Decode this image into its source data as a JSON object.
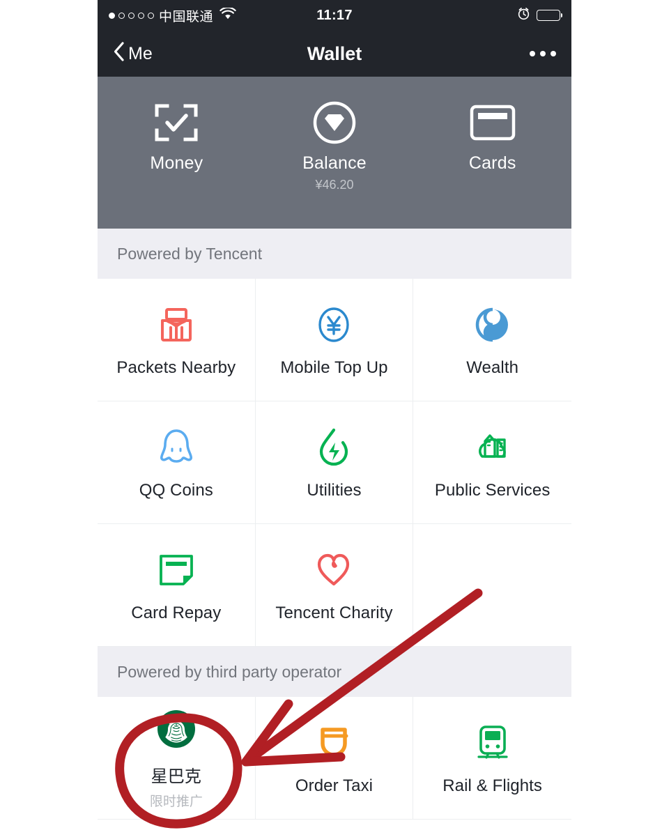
{
  "status_bar": {
    "signal_dots_total": 5,
    "signal_dots_filled": 1,
    "carrier": "中国联通",
    "wifi_icon": "wifi-icon",
    "time": "11:17",
    "alarm_icon": "alarm-clock-icon",
    "battery_icon": "battery-icon"
  },
  "nav": {
    "back_icon": "chevron-left-icon",
    "back_label": "Me",
    "title": "Wallet",
    "more_icon": "more-dots-icon"
  },
  "hero": {
    "background_color": "#6b707a",
    "items": [
      {
        "icon": "scan-money-icon",
        "label": "Money",
        "sub": ""
      },
      {
        "icon": "balance-diamond-icon",
        "label": "Balance",
        "sub": "¥46.20"
      },
      {
        "icon": "bank-card-icon",
        "label": "Cards",
        "sub": ""
      }
    ]
  },
  "sections": [
    {
      "header": "Powered by Tencent",
      "items": [
        {
          "icon": "red-packet-icon",
          "label": "Packets Nearby",
          "sub": "",
          "color": "#f4655c"
        },
        {
          "icon": "yuan-circle-icon",
          "label": "Mobile Top Up",
          "sub": "",
          "color": "#2b89ce"
        },
        {
          "icon": "wealth-icon",
          "label": "Wealth",
          "sub": "",
          "color": "#4a9ad4"
        },
        {
          "icon": "qq-penguin-icon",
          "label": "QQ Coins",
          "sub": "",
          "color": "#5bacf0"
        },
        {
          "icon": "utilities-bolt-icon",
          "label": "Utilities",
          "sub": "",
          "color": "#07b252"
        },
        {
          "icon": "public-services-icon",
          "label": "Public Services",
          "sub": "",
          "color": "#07b252"
        },
        {
          "icon": "card-repay-icon",
          "label": "Card Repay",
          "sub": "",
          "color": "#07b252"
        },
        {
          "icon": "charity-heart-icon",
          "label": "Tencent Charity",
          "sub": "",
          "color": "#ef5a5a"
        },
        {
          "icon": "",
          "label": "",
          "sub": "",
          "color": ""
        }
      ]
    },
    {
      "header": "Powered by third party operator",
      "items": [
        {
          "icon": "starbucks-icon",
          "label": "星巴克",
          "sub": "限时推广",
          "color": "#026e3f"
        },
        {
          "icon": "didi-taxi-icon",
          "label": "Order Taxi",
          "sub": "",
          "color": "#f59a23"
        },
        {
          "icon": "train-icon",
          "label": "Rail & Flights",
          "sub": "",
          "color": "#0aae54"
        }
      ]
    }
  ],
  "annotations": {
    "circle_color": "#b11f24",
    "arrow_color": "#b11f24",
    "circled_target": "星巴克",
    "arrow_points_to": "星巴克"
  }
}
